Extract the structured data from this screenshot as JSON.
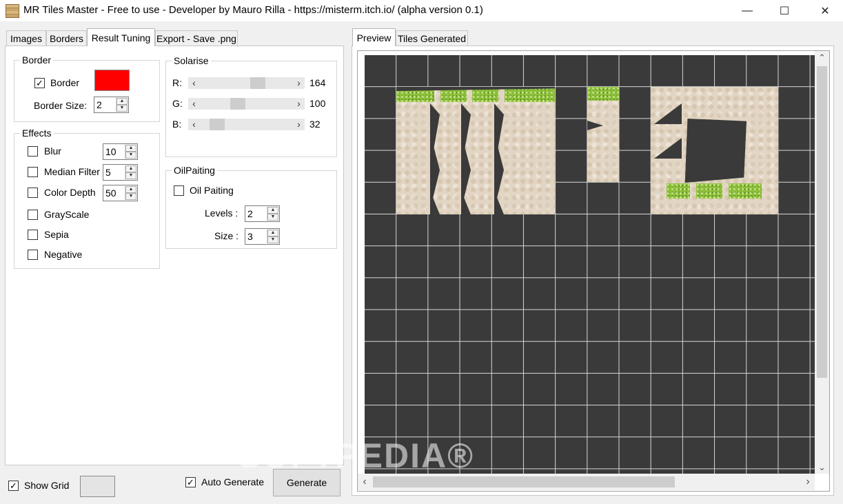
{
  "window": {
    "title": "MR Tiles Master - Free to use  - Developer by Mauro Rilla -  https://misterm.itch.io/ (alpha version 0.1)",
    "minimize_glyph": "—",
    "maximize_glyph": "☐",
    "close_glyph": "✕"
  },
  "left_tabs": [
    {
      "label": "Images"
    },
    {
      "label": "Borders"
    },
    {
      "label": "Result Tuning"
    },
    {
      "label": "Export - Save .png"
    }
  ],
  "right_tabs": [
    {
      "label": "Preview"
    },
    {
      "label": "Tiles Generated"
    }
  ],
  "border_group": {
    "title": "Border",
    "border_checkbox_label": "Border",
    "border_checked": true,
    "border_color": "#ff0000",
    "size_label": "Border Size:",
    "size_value": "2"
  },
  "effects_group": {
    "title": "Effects",
    "items": [
      {
        "label": "Blur",
        "checked": false,
        "value": "10"
      },
      {
        "label": "Median Filter",
        "checked": false,
        "value": "5"
      },
      {
        "label": "Color Depth",
        "checked": false,
        "value": "50"
      },
      {
        "label": "GrayScale",
        "checked": false
      },
      {
        "label": "Sepia",
        "checked": false
      },
      {
        "label": "Negative",
        "checked": false
      }
    ]
  },
  "solarise_group": {
    "title": "Solarise",
    "channels": [
      {
        "label": "R:",
        "value": "164",
        "level": 164
      },
      {
        "label": "G:",
        "value": "100",
        "level": 100
      },
      {
        "label": "B:",
        "value": "32",
        "level": 32
      }
    ],
    "max": 255
  },
  "oil_group": {
    "title": "OilPaiting",
    "checkbox_label": "Oil Paiting",
    "checked": false,
    "levels_label": "Levels :",
    "levels_value": "2",
    "size_label": "Size :",
    "size_value": "3"
  },
  "bottom": {
    "show_grid_label": "Show Grid",
    "show_grid_checked": true,
    "grid_color": "#e4e4e4",
    "auto_generate_label": "Auto Generate",
    "auto_generate_checked": true,
    "generate_label": "Generate"
  },
  "icons": {
    "check": "✓",
    "arrow_left": "‹",
    "arrow_right": "›",
    "arrow_up": "⌃",
    "arrow_down": "⌄",
    "spin_up": "▲",
    "spin_down": "▼"
  },
  "watermark": "SOFTPEDIA®"
}
